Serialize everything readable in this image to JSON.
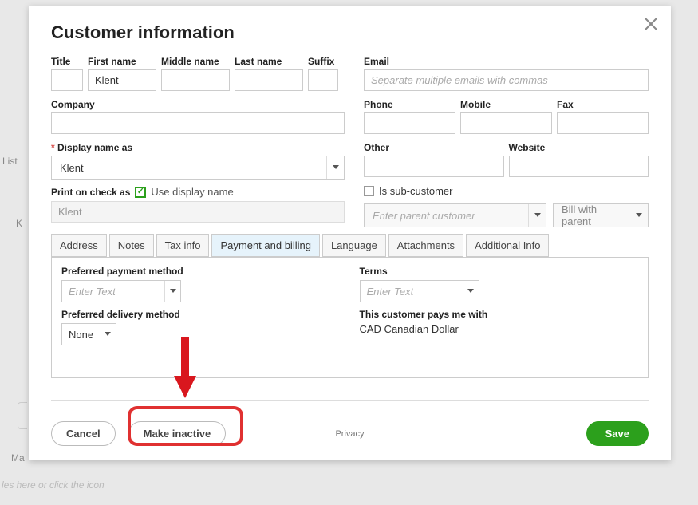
{
  "modal": {
    "title": "Customer information",
    "left": {
      "labels": {
        "title": "Title",
        "first_name": "First name",
        "middle_name": "Middle name",
        "last_name": "Last name",
        "suffix": "Suffix",
        "company": "Company",
        "display_name": "Display name as",
        "print_check": "Print on check as",
        "use_display_name": "Use display name"
      },
      "values": {
        "title": "",
        "first_name": "Klent",
        "middle_name": "",
        "last_name": "",
        "suffix": "",
        "company": "",
        "display_name": "Klent",
        "print_check_value": "Klent"
      }
    },
    "right": {
      "labels": {
        "email": "Email",
        "phone": "Phone",
        "mobile": "Mobile",
        "fax": "Fax",
        "other": "Other",
        "website": "Website",
        "is_subcustomer": "Is sub-customer"
      },
      "email_placeholder": "Separate multiple emails with commas",
      "parent_placeholder": "Enter parent customer",
      "bill_with_parent": "Bill with parent"
    },
    "tabs": [
      "Address",
      "Notes",
      "Tax info",
      "Payment and billing",
      "Language",
      "Attachments",
      "Additional Info"
    ],
    "tab_active_index": 3,
    "panel": {
      "pref_payment_method_label": "Preferred payment method",
      "pref_payment_method_placeholder": "Enter Text",
      "pref_delivery_method_label": "Preferred delivery method",
      "pref_delivery_method_value": "None",
      "terms_label": "Terms",
      "terms_placeholder": "Enter Text",
      "pays_with_label": "This customer pays me with",
      "pays_with_value": "CAD Canadian Dollar"
    },
    "footer": {
      "cancel": "Cancel",
      "make_inactive": "Make inactive",
      "privacy": "Privacy",
      "save": "Save"
    }
  },
  "backdrop": {
    "list_text": "List",
    "k_text": "K",
    "ma_text": "Ma",
    "hint": "les here or click the icon"
  }
}
